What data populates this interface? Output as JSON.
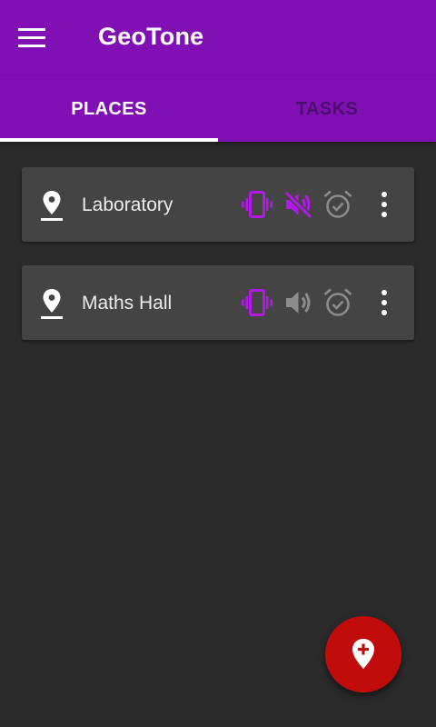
{
  "app": {
    "title": "GeoTone"
  },
  "colors": {
    "primary": "#8010b4",
    "accent_active": "#b318e8",
    "icon_inactive": "#8c8c8c",
    "fab": "#c10c0c",
    "background": "#2a2a2a",
    "card": "#444444"
  },
  "toolbar": {
    "menu_icon": "hamburger-menu-icon"
  },
  "tabs": [
    {
      "label": "PLACES",
      "active": true
    },
    {
      "label": "TASKS",
      "active": false
    }
  ],
  "places": [
    {
      "name": "Laboratory",
      "icons": [
        "map-pin-icon",
        "vibrate-icon",
        "volume-off-icon",
        "alarm-check-icon",
        "more-vert-icon"
      ],
      "vibrate": "on",
      "sound": "muted",
      "alarm": "off"
    },
    {
      "name": "Maths Hall",
      "icons": [
        "map-pin-icon",
        "vibrate-icon",
        "volume-up-icon",
        "alarm-check-icon",
        "more-vert-icon"
      ],
      "vibrate": "on",
      "sound": "on",
      "alarm": "off"
    }
  ],
  "fab": {
    "icon": "add-location-icon"
  }
}
